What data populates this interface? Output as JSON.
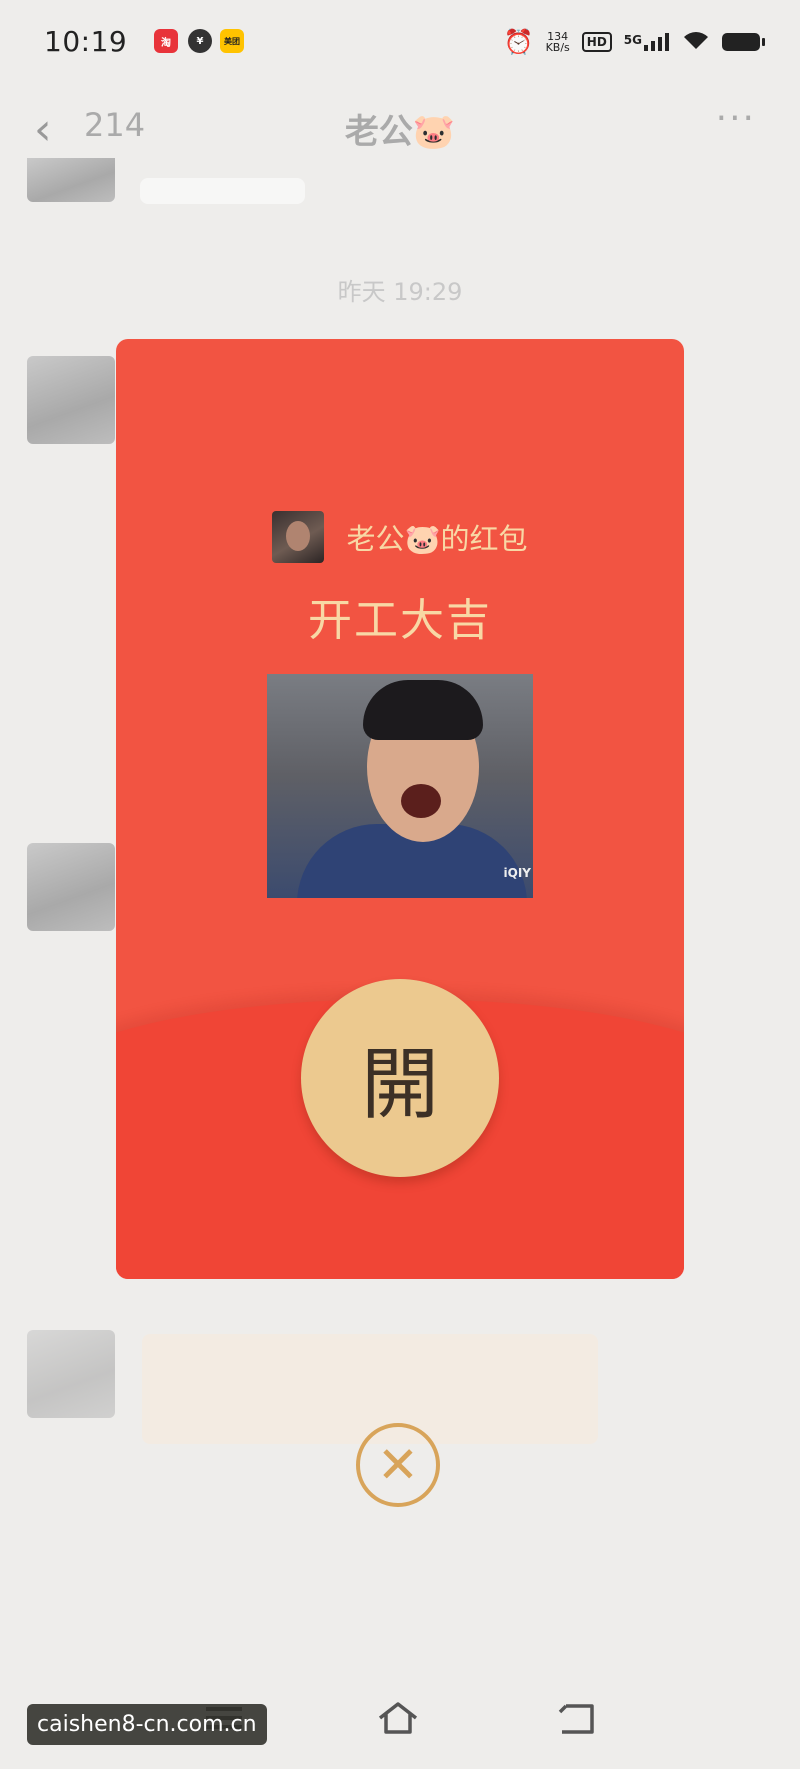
{
  "status_bar": {
    "time": "10:19",
    "apps": [
      {
        "icon": "shopping-app-icon",
        "color": "#e8333a"
      },
      {
        "icon": "payment-app-icon",
        "color": "#333333"
      },
      {
        "icon": "meituan-app-icon",
        "color": "#ffc300",
        "label": "美团"
      }
    ],
    "net_speed_value": "134",
    "net_speed_unit": "KB/s",
    "hd_label": "HD",
    "network_label": "5G"
  },
  "chat": {
    "back_count": "214",
    "title": "老公🐷",
    "timestamp": "昨天 19:29"
  },
  "red_envelope": {
    "sender_title": "老公🐷的红包",
    "greeting": "开工大吉",
    "sticker_watermark": "iQIY",
    "open_label": "開",
    "close_symbol": "✕",
    "accent_color": "#f25442",
    "gold_color": "#ecc98f"
  },
  "watermark": {
    "url": "caishen8-cn.com.cn"
  }
}
